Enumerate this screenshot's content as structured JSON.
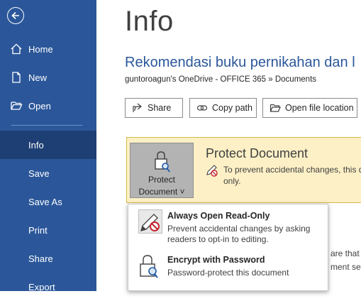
{
  "sidebar": {
    "items": [
      {
        "label": "Home",
        "icon": "home-icon"
      },
      {
        "label": "New",
        "icon": "new-document-icon"
      },
      {
        "label": "Open",
        "icon": "open-folder-icon"
      },
      {
        "label": "Info"
      },
      {
        "label": "Save"
      },
      {
        "label": "Save As"
      },
      {
        "label": "Print"
      },
      {
        "label": "Share"
      },
      {
        "label": "Export"
      }
    ],
    "active": "Info",
    "colors": {
      "background": "#2b579a",
      "active": "#1e3f74"
    }
  },
  "main": {
    "page_title": "Info",
    "doc_title": "Rekomendasi buku pernikahan dan l",
    "doc_path": "guntoroagun's OneDrive - OFFICE 365 » Documents",
    "buttons": [
      {
        "label": "Share",
        "icon": "share-icon"
      },
      {
        "label": "Copy path",
        "icon": "link-icon"
      },
      {
        "label": "Open file location",
        "icon": "folder-icon"
      }
    ]
  },
  "protect": {
    "button_line1": "Protect",
    "button_line2": "Document ˅",
    "title": "Protect Document",
    "description": "To prevent accidental changes, this d only.",
    "panel_color": "#fdf0c6"
  },
  "menu": {
    "items": [
      {
        "title": "Always Open Read-Only",
        "description": "Prevent accidental changes by asking readers to opt-in to editing.",
        "icon": "read-only-pencil-icon"
      },
      {
        "title": "Encrypt with Password",
        "description": "Password-protect this document",
        "icon": "lock-key-icon"
      }
    ]
  },
  "background_text": {
    "line1": "are that it",
    "line2": "ment serv"
  }
}
